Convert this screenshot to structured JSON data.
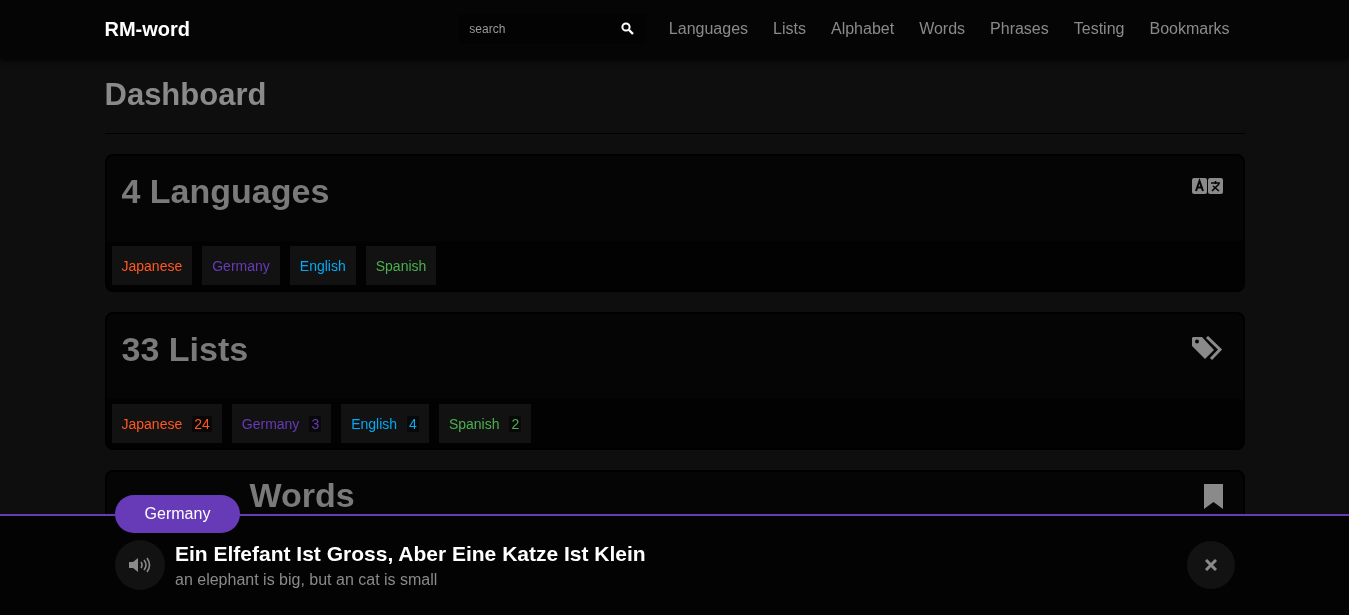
{
  "navbar": {
    "brand": "RM-word",
    "search": {
      "placeholder": "search"
    },
    "links": [
      "Languages",
      "Lists",
      "Alphabet",
      "Words",
      "Phrases",
      "Testing",
      "Bookmarks"
    ]
  },
  "page": {
    "title": "Dashboard"
  },
  "cards": [
    {
      "title": "4 Languages",
      "tags": [
        {
          "label": "Japanese",
          "color": "#ff5722"
        },
        {
          "label": "Germany",
          "color": "#673ab7"
        },
        {
          "label": "English",
          "color": "#03a9f4"
        },
        {
          "label": "Spanish",
          "color": "#4caf50"
        }
      ]
    },
    {
      "title": "33 Lists",
      "tags": [
        {
          "label": "Japanese",
          "count": "24",
          "color": "#ff5722"
        },
        {
          "label": "Germany",
          "count": "3",
          "color": "#673ab7"
        },
        {
          "label": "English",
          "count": "4",
          "color": "#03a9f4"
        },
        {
          "label": "Spanish",
          "count": "2",
          "color": "#4caf50"
        }
      ]
    },
    {
      "title": "Words"
    }
  ],
  "player": {
    "language": "Germany",
    "phrase": "Ein Elfefant Ist Gross, Aber Eine Katze Ist Klein",
    "translation": "an elephant is big, but an cat is small"
  }
}
